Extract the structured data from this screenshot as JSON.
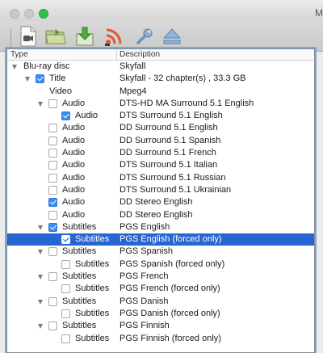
{
  "window": {
    "title": "M"
  },
  "toolbar": {
    "buttons": [
      {
        "name": "open-disc-button",
        "icon": "video-file-icon"
      },
      {
        "name": "open-folder-button",
        "icon": "folder-icon"
      },
      {
        "name": "save-button",
        "icon": "download-icon"
      },
      {
        "name": "stream-button",
        "icon": "rss-icon"
      },
      {
        "name": "settings-button",
        "icon": "wrench-icon"
      },
      {
        "name": "eject-button",
        "icon": "eject-icon"
      }
    ]
  },
  "tree": {
    "columns": [
      "Type",
      "Description"
    ],
    "rows": [
      {
        "type": "Blu-ray disc",
        "desc": "Skyfall"
      },
      {
        "type": "Title",
        "desc": "Skyfall - 32 chapter(s) , 33.3 GB"
      },
      {
        "type": "Video",
        "desc": "Mpeg4"
      },
      {
        "type": "Audio",
        "desc": "DTS-HD MA Surround 5.1 English"
      },
      {
        "type": "Audio",
        "desc": "DTS Surround 5.1 English"
      },
      {
        "type": "Audio",
        "desc": "DD Surround 5.1 English"
      },
      {
        "type": "Audio",
        "desc": "DD Surround 5.1 Spanish"
      },
      {
        "type": "Audio",
        "desc": "DD Surround 5.1 French"
      },
      {
        "type": "Audio",
        "desc": "DTS Surround 5.1 Italian"
      },
      {
        "type": "Audio",
        "desc": "DTS Surround 5.1 Russian"
      },
      {
        "type": "Audio",
        "desc": "DTS Surround 5.1 Ukrainian"
      },
      {
        "type": "Audio",
        "desc": "DD Stereo English"
      },
      {
        "type": "Audio",
        "desc": "DD Stereo English"
      },
      {
        "type": "Subtitles",
        "desc": "PGS English"
      },
      {
        "type": "Subtitles",
        "desc": "PGS English  (forced only)"
      },
      {
        "type": "Subtitles",
        "desc": "PGS Spanish"
      },
      {
        "type": "Subtitles",
        "desc": "PGS Spanish  (forced only)"
      },
      {
        "type": "Subtitles",
        "desc": "PGS French"
      },
      {
        "type": "Subtitles",
        "desc": "PGS French  (forced only)"
      },
      {
        "type": "Subtitles",
        "desc": "PGS Danish"
      },
      {
        "type": "Subtitles",
        "desc": "PGS Danish  (forced only)"
      },
      {
        "type": "Subtitles",
        "desc": "PGS Finnish"
      },
      {
        "type": "Subtitles",
        "desc": "PGS Finnish  (forced only)"
      }
    ]
  },
  "state": {
    "checked": [
      1,
      4,
      11,
      13,
      14
    ],
    "selected": 14,
    "expanded": [
      0,
      1,
      3,
      13,
      15,
      17,
      19,
      21
    ]
  },
  "colors": {
    "selection": "#2665d2",
    "checkbox": "#3d8cf5",
    "focus_ring": "#7aa7df"
  }
}
